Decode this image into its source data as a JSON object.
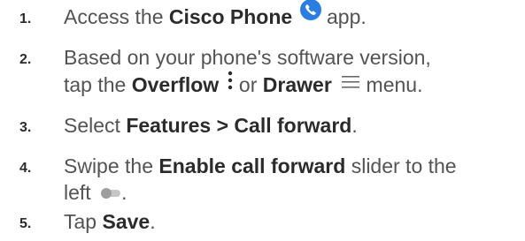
{
  "steps": [
    {
      "number": "1.",
      "pre": "Access the ",
      "bold": "Cisco Phone",
      "icon": "phone-app-icon",
      "post": " app."
    },
    {
      "number": "2.",
      "line1": "Based on your phone's software version,",
      "pre": "tap the ",
      "bold1": "Overflow",
      "icon1": "overflow-menu-icon",
      "mid": " or ",
      "bold2": "Drawer",
      "icon2": "drawer-menu-icon",
      "post": " menu."
    },
    {
      "number": "3.",
      "pre": "Select ",
      "bold": "Features > Call forward",
      "post": "."
    },
    {
      "number": "4.",
      "pre": "Swipe the ",
      "bold": "Enable call forward",
      "post": " slider to the",
      "line2": "left",
      "icon": "toggle-off-icon",
      "post2": "."
    },
    {
      "number": "5.",
      "pre": "Tap ",
      "bold": "Save",
      "post": "."
    }
  ],
  "colors": {
    "text": "#535353",
    "bold_text": "#2b2b2b",
    "phone_icon": "#2a7de1",
    "toggle": "#b9b9b9"
  }
}
